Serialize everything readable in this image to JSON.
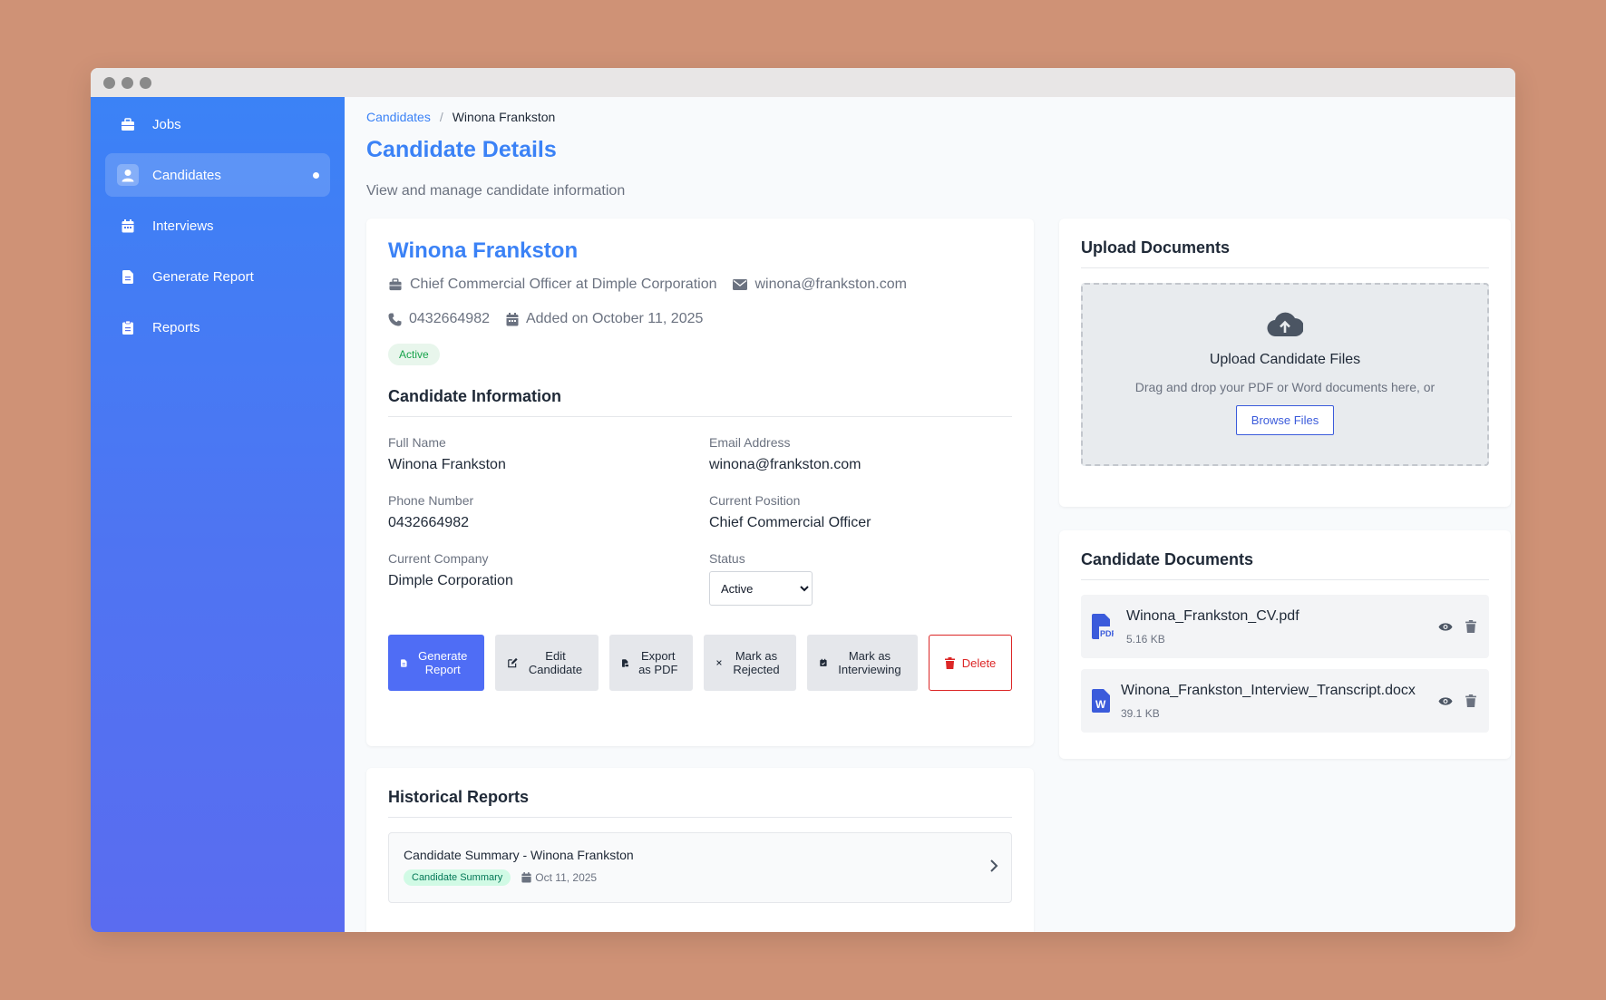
{
  "sidebar": {
    "items": [
      {
        "label": "Jobs",
        "icon": "briefcase-icon"
      },
      {
        "label": "Candidates",
        "icon": "user-icon",
        "active": true
      },
      {
        "label": "Interviews",
        "icon": "calendar-icon"
      },
      {
        "label": "Generate Report",
        "icon": "file-icon"
      },
      {
        "label": "Reports",
        "icon": "clipboard-icon"
      }
    ]
  },
  "breadcrumb": {
    "parent": "Candidates",
    "separator": "/",
    "current": "Winona Frankston"
  },
  "page": {
    "title": "Candidate Details",
    "subtitle": "View and manage candidate information"
  },
  "candidate": {
    "name": "Winona Frankston",
    "position_line": "Chief Commercial Officer at Dimple Corporation",
    "email": "winona@frankston.com",
    "phone": "0432664982",
    "added": "Added on October 11, 2025",
    "status_badge": "Active"
  },
  "info": {
    "section_title": "Candidate Information",
    "full_name_label": "Full Name",
    "full_name": "Winona Frankston",
    "email_label": "Email Address",
    "email": "winona@frankston.com",
    "phone_label": "Phone Number",
    "phone": "0432664982",
    "position_label": "Current Position",
    "position": "Chief Commercial Officer",
    "company_label": "Current Company",
    "company": "Dimple Corporation",
    "status_label": "Status",
    "status": "Active"
  },
  "actions": {
    "generate": "Generate Report",
    "edit": "Edit Candidate",
    "export": "Export as PDF",
    "reject": "Mark as Rejected",
    "interviewing": "Mark as Interviewing",
    "delete": "Delete"
  },
  "history": {
    "title": "Historical Reports",
    "reports": [
      {
        "title": "Candidate Summary - Winona Frankston",
        "tag": "Candidate Summary",
        "date": "Oct 11, 2025"
      }
    ]
  },
  "upload": {
    "title": "Upload Documents",
    "dz_title": "Upload Candidate Files",
    "dz_text": "Drag and drop your PDF or Word documents here, or",
    "browse": "Browse Files"
  },
  "documents": {
    "title": "Candidate Documents",
    "items": [
      {
        "name": "Winona_Frankston_CV.pdf",
        "size": "5.16 KB",
        "icon": "pdf-file-icon"
      },
      {
        "name": "Winona_Frankston_Interview_Transcript.docx",
        "size": "39.1 KB",
        "icon": "word-file-icon"
      }
    ]
  },
  "colors": {
    "accent": "#3b82f6",
    "primary_button": "#4f6df5",
    "danger": "#dc2626",
    "success": "#16a34a"
  }
}
